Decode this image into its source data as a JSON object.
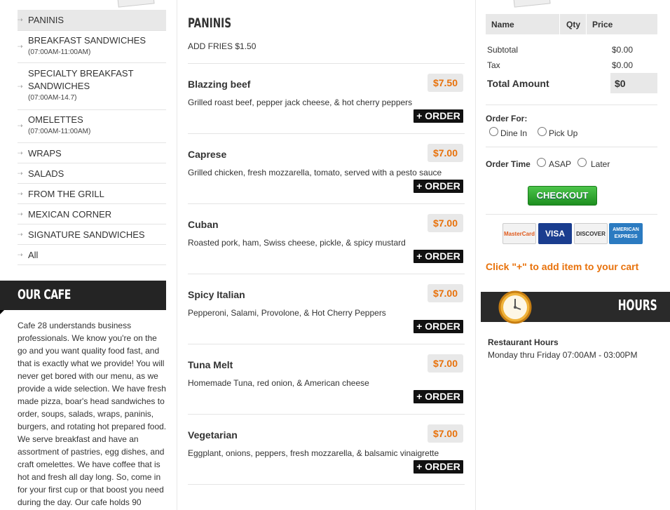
{
  "categories": [
    {
      "name": "PANINIS",
      "sub": ""
    },
    {
      "name": "BREAKFAST SANDWICHES",
      "sub": "(07:00AM-11:00AM)"
    },
    {
      "name": "SPECIALTY BREAKFAST SANDWICHES",
      "sub": "(07:00AM-14.7)"
    },
    {
      "name": "OMELETTES",
      "sub": "(07:00AM-11:00AM)"
    },
    {
      "name": "WRAPS",
      "sub": ""
    },
    {
      "name": "SALADS",
      "sub": ""
    },
    {
      "name": "FROM THE GRILL",
      "sub": ""
    },
    {
      "name": "MEXICAN CORNER",
      "sub": ""
    },
    {
      "name": "SIGNATURE SANDWICHES",
      "sub": ""
    },
    {
      "name": "All",
      "sub": ""
    }
  ],
  "our_cafe": {
    "title": "OUR CAFE",
    "text": "Cafe 28 understands business professionals. We know you're on the go and you want quality food fast, and that is exactly what we provide! You will never get bored with our menu, as we provide a wide selection. We have fresh made pizza, boar's head sandwiches to order, soups, salads, wraps, paninis, burgers, and rotating hot prepared food. We serve breakfast and have an assortment of pastries, egg dishes, and craft omelettes. We have coffee that is hot and fresh all day long. So, come in for your first cup or that boost you need during the day. Our cafe holds 90"
  },
  "menu": {
    "title": "PANINIS",
    "subtitle": "ADD FRIES $1.50",
    "order_label": "+ ORDER",
    "items": [
      {
        "name": "Blazzing beef",
        "desc": "Grilled roast beef, pepper jack cheese, & hot cherry peppers",
        "price": "$7.50"
      },
      {
        "name": "Caprese",
        "desc": "Grilled chicken, fresh mozzarella, tomato, served with a pesto sauce",
        "price": "$7.00"
      },
      {
        "name": "Cuban",
        "desc": "Roasted pork, ham, Swiss cheese, pickle, & spicy mustard",
        "price": "$7.00"
      },
      {
        "name": "Spicy Italian",
        "desc": "Pepperoni, Salami, Provolone, & Hot Cherry Peppers",
        "price": "$7.00"
      },
      {
        "name": "Tuna Melt",
        "desc": "Homemade Tuna, red onion, & American cheese",
        "price": "$7.00"
      },
      {
        "name": "Vegetarian",
        "desc": "Eggplant, onions, peppers, fresh mozzarella, & balsamic vinaigrette",
        "price": "$7.00"
      }
    ]
  },
  "cart": {
    "col_name": "Name",
    "col_qty": "Qty",
    "col_price": "Price",
    "subtotal_label": "Subtotal",
    "subtotal_value": "$0.00",
    "tax_label": "Tax",
    "tax_value": "$0.00",
    "total_label": "Total Amount",
    "total_value": "$0",
    "order_for_label": "Order For:",
    "dine_in": "Dine In",
    "pick_up": "Pick Up",
    "order_time_label": "Order Time",
    "asap": "ASAP",
    "later": "Later",
    "checkout": "CHECKOUT",
    "cards": [
      "MasterCard",
      "VISA",
      "DISCOVER",
      "AMERICAN EXPRESS"
    ],
    "add_hint": "Click \"+\" to add item to your cart"
  },
  "hours": {
    "title": "HOURS",
    "label": "Restaurant Hours",
    "text": "Monday thru Friday 07:00AM - 03:00PM"
  },
  "colors": {
    "accent": "#e8720c",
    "banner": "#242424",
    "button_green": "#2aa52c"
  }
}
